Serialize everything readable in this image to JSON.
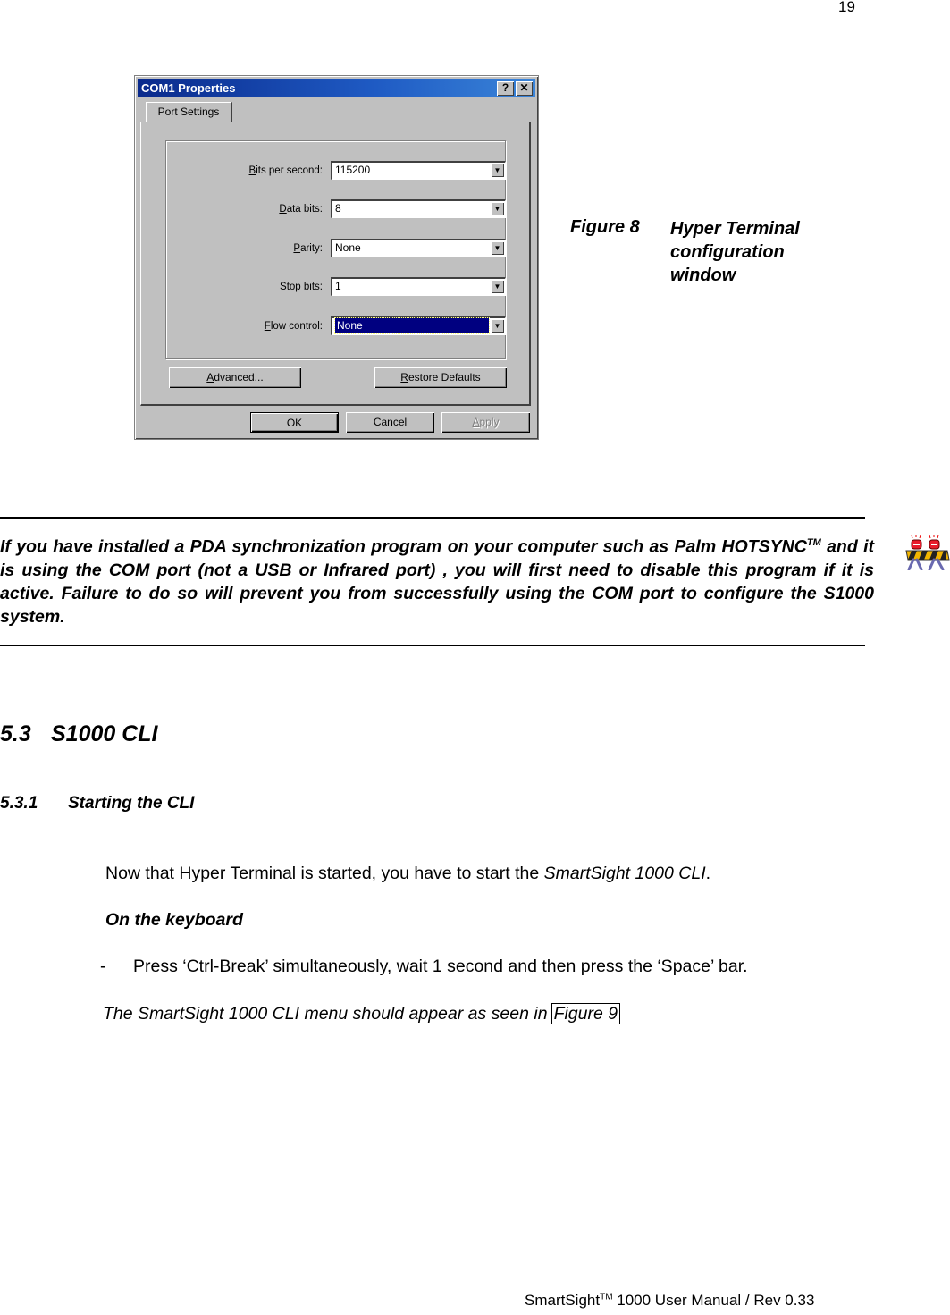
{
  "page_number": "19",
  "dialog": {
    "title": "COM1 Properties",
    "help_button": "?",
    "close_button": "✕",
    "tab": "Port Settings",
    "fields": [
      {
        "label_first": "B",
        "label_rest": "its per second:",
        "value": "115200"
      },
      {
        "label_first": "D",
        "label_rest": "ata bits:",
        "value": "8"
      },
      {
        "label_first": "P",
        "label_rest": "arity:",
        "value": "None"
      },
      {
        "label_first": "S",
        "label_rest": "top bits:",
        "value": "1"
      },
      {
        "label_first": "F",
        "label_rest": "low control:",
        "value": "None"
      }
    ],
    "dropdown_arrow": "▼",
    "advanced_first": "A",
    "advanced_rest": "dvanced...",
    "restore_first": "R",
    "restore_rest": "estore Defaults",
    "ok": "OK",
    "cancel": "Cancel",
    "apply_first": "A",
    "apply_rest": "pply"
  },
  "caption": {
    "label": "Figure 8",
    "text": "Hyper Terminal configuration window"
  },
  "note": {
    "part1": "If you have installed a PDA synchronization program on your computer such as Palm HOTSYNC",
    "tm": "TM",
    "part2": " and it is using the COM port (not a USB or Infrared port) , you will first need to disable this program if it is active.  Failure to do so will prevent you from successfully using the COM port to configure the S1000 system.",
    "icon": "warning-barricade-icon"
  },
  "section": {
    "number": "5.3",
    "title": "S1000 CLI"
  },
  "subsection": {
    "number": "5.3.1",
    "title": "Starting the CLI"
  },
  "body": {
    "intro_plain": "Now that Hyper Terminal is started, you have to start the ",
    "intro_italic": "SmartSight 1000 CLI",
    "intro_end": ".",
    "keyboard_heading": "On the keyboard",
    "bullet_dash": "-",
    "bullet_text": "Press ‘Ctrl-Break’ simultaneously, wait 1 second and then press the ‘Space’ bar.",
    "result_text": "The SmartSight 1000 CLI menu should appear as seen in",
    "result_link": "Figure 9"
  },
  "footer": {
    "brand": "SmartSight",
    "tm": "TM",
    "rest": " 1000 User Manual / Rev 0.33"
  }
}
